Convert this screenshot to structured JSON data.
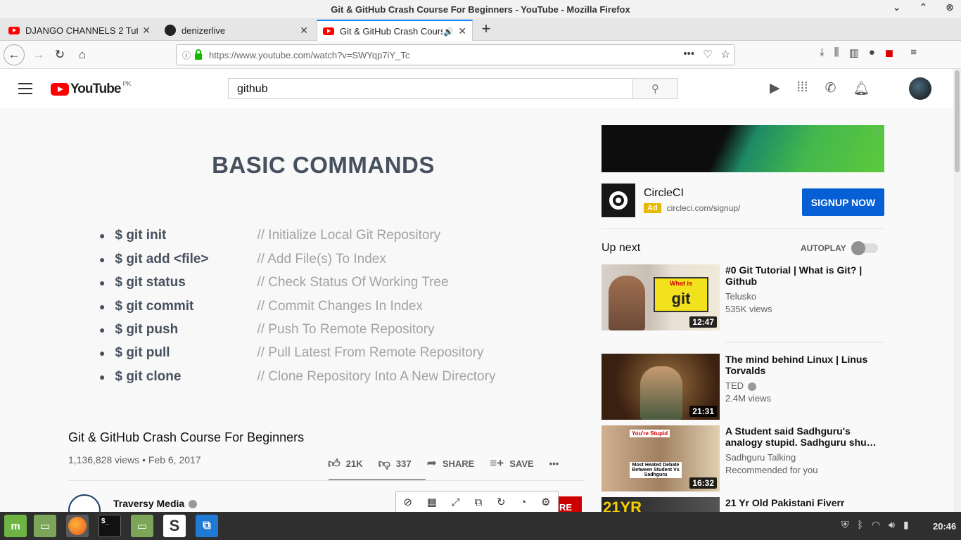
{
  "window": {
    "title": "Git & GitHub Crash Course For Beginners - YouTube - Mozilla Firefox",
    "controls": [
      "⌃",
      "⨂"
    ]
  },
  "tabs": [
    {
      "label": "DJANGO CHANNELS 2 Tuto",
      "icon": "youtube-favicon"
    },
    {
      "label": "denizerlive",
      "icon": "github-favicon"
    },
    {
      "label": "Git & GitHub Crash Cours",
      "icon": "youtube-favicon",
      "audio": "🔊"
    }
  ],
  "navbar": {
    "url": "https://www.youtube.com/watch?v=SWYqp7iY_Tc",
    "more": "•••"
  },
  "youtube": {
    "logo_text": "YouTube",
    "logo_region": "PK",
    "search_value": "github"
  },
  "slide": {
    "title": "BASIC COMMANDS",
    "commands": [
      {
        "cmd": "$ git init",
        "desc": "// Initialize Local Git Repository"
      },
      {
        "cmd": "$ git add <file>",
        "desc": "// Add File(s) To Index"
      },
      {
        "cmd": "$ git status",
        "desc": "// Check Status Of Working Tree"
      },
      {
        "cmd": "$ git commit",
        "desc": "// Commit Changes In Index"
      },
      {
        "cmd": "$ git push",
        "desc": "// Push To Remote Repository"
      },
      {
        "cmd": "$ git pull",
        "desc": "// Pull Latest From Remote Repository"
      },
      {
        "cmd": "$ git clone",
        "desc": "// Clone Repository Into A New Directory"
      }
    ]
  },
  "video": {
    "title": "Git & GitHub Crash Course For Beginners",
    "meta": "1,136,828 views • Feb 6, 2017",
    "likes": "21K",
    "dislikes": "337",
    "share_label": "SHARE",
    "save_label": "SAVE",
    "more": "•••"
  },
  "channel": {
    "name": "Traversy Media",
    "subscribe_partial": "RE"
  },
  "ad": {
    "name": "CircleCI",
    "badge": "Ad",
    "url": "circleci.com/signup/",
    "cta": "SIGNUP NOW",
    "info": "ⓘ"
  },
  "sidebar": {
    "up_next": "Up next",
    "autoplay": "AUTOPLAY",
    "autoplay_on": false
  },
  "recommendations": [
    {
      "title": "#0 Git Tutorial | What is Git? | Github",
      "channel": "Telusko",
      "views": "535K views",
      "duration": "12:47",
      "thumb_text": "git",
      "thumb_small": "What is"
    },
    {
      "title": "The mind behind Linux | Linus Torvalds",
      "channel": "TED",
      "views": "2.4M views",
      "duration": "21:31"
    },
    {
      "title": "A Student said Sadhguru's analogy stupid. Sadhguru shu…",
      "channel": "Sadhguru Talking",
      "views": "Recommended for you",
      "duration": "16:32",
      "thumb_label1": "You're Stupid",
      "thumb_label2": "Most Heated Debate Between Student Vs Sadhguru"
    },
    {
      "title": "21 Yr Old Pakistani Fiverr",
      "channel": "",
      "views": "",
      "duration": "",
      "thumb_text": "21YR"
    }
  ],
  "taskbar": {
    "clock": "20:46",
    "terminal_glyph": "$_",
    "slack_glyph": "S",
    "vscode_glyph": "⧉"
  },
  "colors": {
    "youtube_red": "#ff0000",
    "signup_blue": "#065fd4",
    "ad_badge": "#e6b800",
    "slide_text": "#46505e",
    "slide_desc": "#a3a3a3"
  }
}
